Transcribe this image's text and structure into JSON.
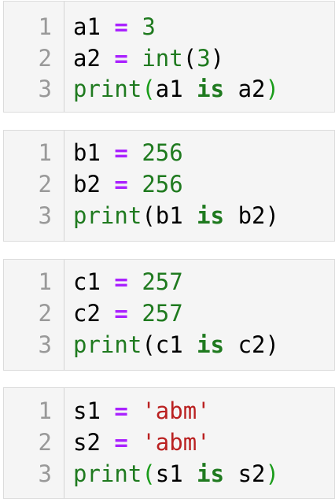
{
  "cells": [
    {
      "line_numbers": [
        "1",
        "2",
        "3"
      ],
      "lines": [
        {
          "var": "a1",
          "op": "=",
          "num": "3"
        },
        {
          "var": "a2",
          "op": "=",
          "fn": "int",
          "open": "(",
          "arg": "3",
          "close": ")"
        },
        {
          "fn": "print",
          "open": "(",
          "left": "a1",
          "kw": "is",
          "right": "a2",
          "close": ")"
        }
      ]
    },
    {
      "line_numbers": [
        "1",
        "2",
        "3"
      ],
      "lines": [
        {
          "var": "b1",
          "op": "=",
          "num": "256"
        },
        {
          "var": "b2",
          "op": "=",
          "num": "256"
        },
        {
          "fn": "print",
          "open": "(",
          "left": "b1",
          "kw": "is",
          "right": "b2",
          "close": ")"
        }
      ]
    },
    {
      "line_numbers": [
        "1",
        "2",
        "3"
      ],
      "lines": [
        {
          "var": "c1",
          "op": "=",
          "num": "257"
        },
        {
          "var": "c2",
          "op": "=",
          "num": "257"
        },
        {
          "fn": "print",
          "open": "(",
          "left": "c1",
          "kw": "is",
          "right": "c2",
          "close": ")"
        }
      ]
    },
    {
      "line_numbers": [
        "1",
        "2",
        "3"
      ],
      "lines": [
        {
          "var": "s1",
          "op": "=",
          "str": "'abm'"
        },
        {
          "var": "s2",
          "op": "=",
          "str": "'abm'"
        },
        {
          "fn": "print",
          "open": "(",
          "left": "s1",
          "kw": "is",
          "right": "s2",
          "close": ")"
        }
      ]
    }
  ],
  "colors": {
    "cell_background": "#f5f5f5",
    "line_number": "#999999",
    "operator": "#aa22ff",
    "number": "#1f7a1f",
    "builtin": "#1f7a1f",
    "keyword": "#1f7a1f",
    "string": "#ba2121"
  }
}
